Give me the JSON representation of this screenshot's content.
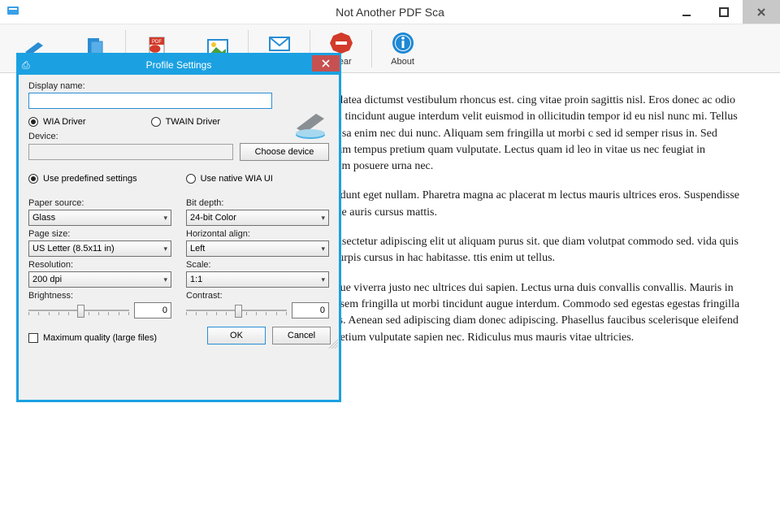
{
  "window": {
    "title": "Not Another PDF Sca"
  },
  "toolbar": {
    "items": [
      {
        "label": ""
      },
      {
        "label": ""
      },
      {
        "label": ""
      },
      {
        "label": ""
      },
      {
        "label": "PDF"
      },
      {
        "label": "Clear"
      },
      {
        "label": "About"
      }
    ]
  },
  "content": {
    "p1": "bitasse platea dictumst vestibulum rhoncus est. cing vitae proin sagittis nisl. Eros donec ac odio Ut morbi tincidunt augue interdum velit euismod in ollicitudin tempor id eu nisl nunc mi. Tellus molestie sa enim nec dui nunc. Aliquam sem fringilla ut morbi c sed id semper risus in. Sed elementum tempus pretium quam vulputate. Lectus quam id leo in vitae us nec feugiat in fermentum posuere urna nec.",
    "p2": "nisl tincidunt eget nullam. Pharetra magna ac placerat m lectus mauris ultrices eros. Suspendisse in est ante auris cursus mattis.",
    "p3": "amet consectetur adipiscing elit ut aliquam purus sit. que diam volutpat commodo sed. vida quis blandit turpis cursus in hac habitasse. ttis enim ut tellus.",
    "p4": "urna neque viverra justo nec ultrices dui sapien. Lectus urna duis convallis convallis. Mauris in aliquam sem fringilla ut morbi tincidunt augue interdum. Commodo sed egestas egestas fringilla phasellus. Aenean sed adipiscing diam donec adipiscing. Phasellus faucibus scelerisque eleifend donec pretium vulputate sapien nec. Ridiculus mus mauris vitae ultricies."
  },
  "dialog": {
    "title": "Profile Settings",
    "display_name_label": "Display name:",
    "display_name_value": "",
    "driver": {
      "wia": "WIA Driver",
      "twain": "TWAIN Driver",
      "selected": "wia"
    },
    "device_label": "Device:",
    "device_value": "",
    "choose_device": "Choose device",
    "settings_mode": {
      "predefined": "Use predefined settings",
      "native": "Use native WIA UI",
      "selected": "predefined"
    },
    "paper_source_label": "Paper source:",
    "paper_source_value": "Glass",
    "page_size_label": "Page size:",
    "page_size_value": "US Letter (8.5x11 in)",
    "resolution_label": "Resolution:",
    "resolution_value": "200 dpi",
    "brightness_label": "Brightness:",
    "brightness_value": "0",
    "bit_depth_label": "Bit depth:",
    "bit_depth_value": "24-bit Color",
    "halign_label": "Horizontal align:",
    "halign_value": "Left",
    "scale_label": "Scale:",
    "scale_value": "1:1",
    "contrast_label": "Contrast:",
    "contrast_value": "0",
    "max_quality": "Maximum quality (large files)",
    "ok": "OK",
    "cancel": "Cancel"
  }
}
